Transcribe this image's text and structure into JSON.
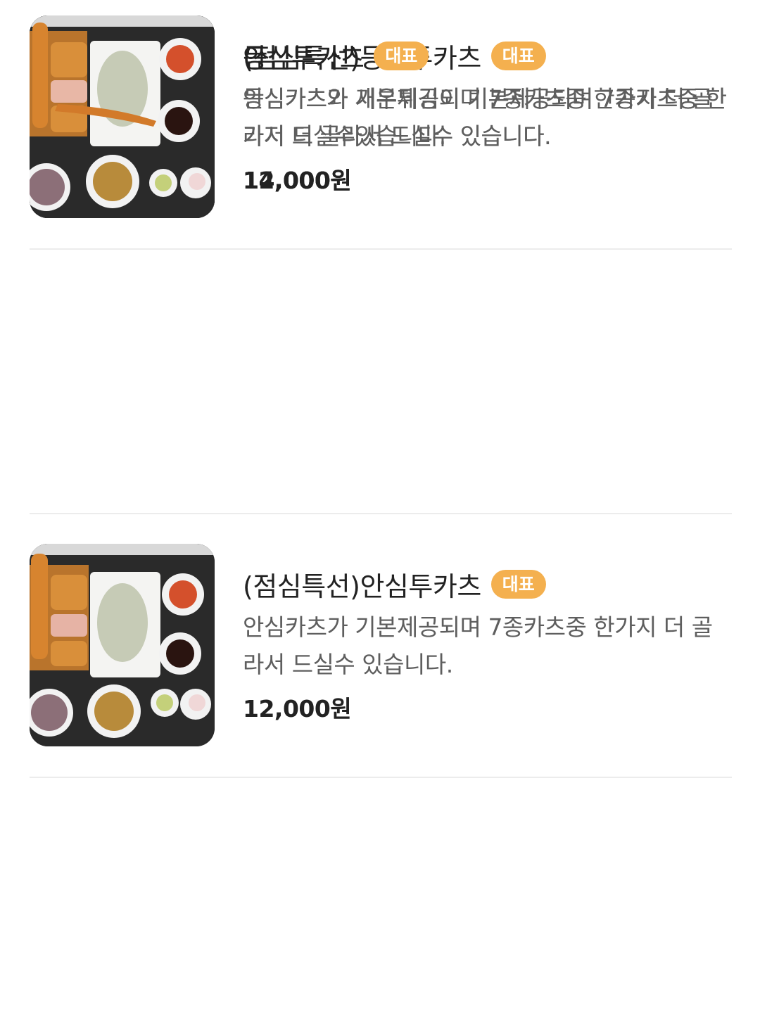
{
  "menu": {
    "items": [
      {
        "title": "(점심특선)등심투카츠",
        "badge": "대표",
        "description": "등심카츠가 기본제공되며 7종카츠중 한가지 더 골라서 드실수있습니다.",
        "price": "12,000원",
        "photo": "food-photo"
      },
      {
        "title": "(점심특선)안심투카츠",
        "badge": "대표",
        "description": "안심카츠가 기본제공되며 7종카츠중 한가지 더 골라서 드실수 있습니다.",
        "price": "12,000원",
        "photo": "food-photo"
      },
      {
        "title": "등심투카츠",
        "badge": "대표",
        "description": "등심카츠와 새우튀김이 기본제공되며 7종카츠중 한가지 더 골라서 드실수 있습니다.",
        "price": "14,000원",
        "photo": "food-photo"
      },
      {
        "title": "안심투카츠",
        "badge": "대표",
        "description": "안심카츠와 새우튀김이 기본제공되며 7종카츠중 한가지 더 골라서 드실수 있습니다.",
        "price": "14,000원",
        "photo": "food-photo"
      }
    ]
  },
  "colors": {
    "badge": "#f4b04f",
    "title": "#222222",
    "description": "#5e5e5e",
    "divider": "#ececec"
  }
}
